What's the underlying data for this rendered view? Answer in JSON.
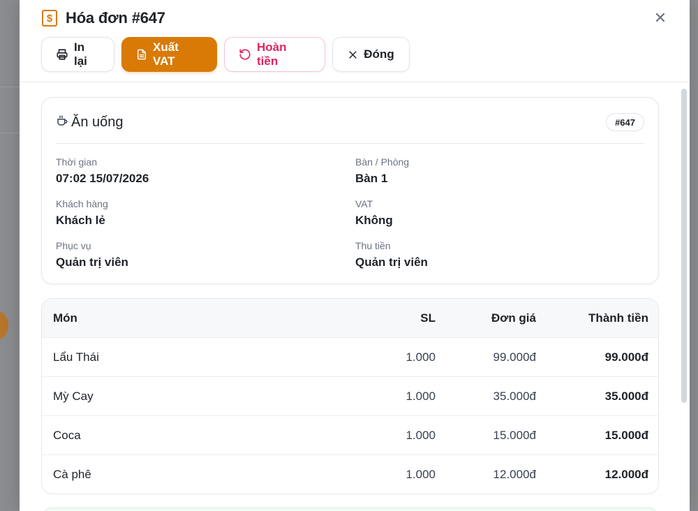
{
  "modal": {
    "title": "Hóa đơn #647",
    "title_icon": "dollar-receipt-icon",
    "close_icon": "close-icon"
  },
  "toolbar": {
    "print_label": "In lại",
    "vat_label": "Xuất VAT",
    "refund_label": "Hoàn tiền",
    "close_label": "Đóng"
  },
  "colors": {
    "accent": "#d97a06",
    "danger": "#e0245e"
  },
  "card": {
    "title": "Ăn uống",
    "badge": "#647",
    "fields": [
      {
        "label": "Thời gian",
        "value": "07:02 15/07/2026"
      },
      {
        "label": "Bàn / Phòng",
        "value": "Bàn 1"
      },
      {
        "label": "Khách hàng",
        "value": "Khách lẻ"
      },
      {
        "label": "VAT",
        "value": "Không"
      },
      {
        "label": "Phục vụ",
        "value": "Quản trị viên"
      },
      {
        "label": "Thu tiền",
        "value": "Quản trị viên"
      }
    ]
  },
  "table": {
    "headers": {
      "name": "Món",
      "qty": "SL",
      "price": "Đơn giá",
      "total": "Thành tiền"
    },
    "rows": [
      {
        "name": "Lẩu Thái",
        "qty": "1.000",
        "price": "99.000đ",
        "total": "99.000đ"
      },
      {
        "name": "Mỳ Cay",
        "qty": "1.000",
        "price": "35.000đ",
        "total": "35.000đ"
      },
      {
        "name": "Coca",
        "qty": "1.000",
        "price": "15.000đ",
        "total": "15.000đ"
      },
      {
        "name": "Cà phê",
        "qty": "1.000",
        "price": "12.000đ",
        "total": "12.000đ"
      }
    ]
  }
}
